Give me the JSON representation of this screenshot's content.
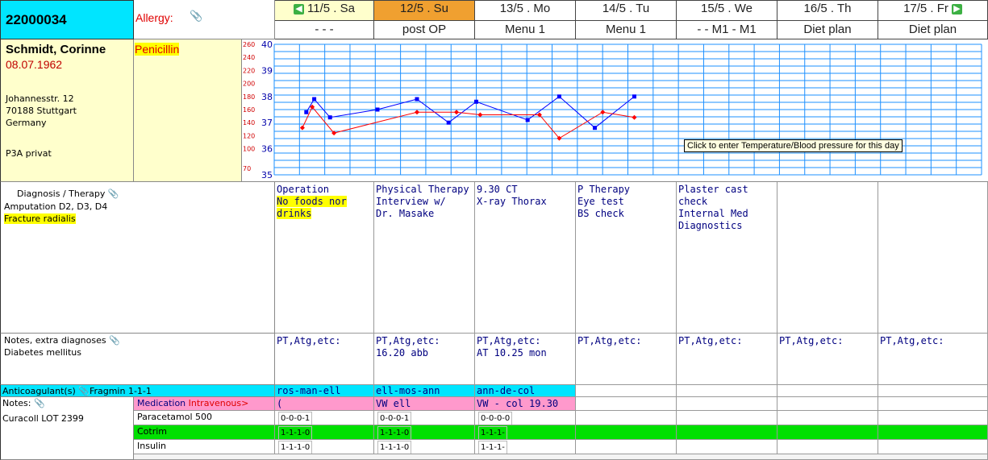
{
  "patient": {
    "id": "22000034",
    "name": "Schmidt, Corinne",
    "birthdate": "08.07.1962",
    "street": "Johannesstr. 12",
    "city": "70188 Stuttgart",
    "country": "Germany",
    "ward": "P3A privat"
  },
  "allergy": {
    "label": "Allergy:",
    "value": "Penicillin"
  },
  "days": [
    {
      "label": "11/5 . Sa",
      "menu": "- - -",
      "bg": "#ffffcc"
    },
    {
      "label": "12/5 . Su",
      "menu": "post OP",
      "bg": "#f0a030"
    },
    {
      "label": "13/5 . Mo",
      "menu": "Menu 1",
      "bg": "#ffffff"
    },
    {
      "label": "14/5 . Tu",
      "menu": "Menu 1",
      "bg": "#ffffff"
    },
    {
      "label": "15/5 . We",
      "menu": "- - M1 - M1",
      "bg": "#ffffff"
    },
    {
      "label": "16/5 . Th",
      "menu": "Diet plan",
      "bg": "#ffffff"
    },
    {
      "label": "17/5 . Fr",
      "menu": "Diet plan",
      "bg": "#ffffff"
    }
  ],
  "chart": {
    "temp_labels": [
      "40",
      "39",
      "38",
      "37",
      "36",
      "35"
    ],
    "bp_labels": [
      "260",
      "240",
      "220",
      "200",
      "180",
      "160",
      "140",
      "120",
      "100",
      "70"
    ],
    "tooltip": "Click to enter Temperature/Blood pressure for this day"
  },
  "chart_data": {
    "type": "line",
    "series": [
      {
        "values": [
          [
            0.2,
            37.4
          ],
          [
            0.4,
            37.9
          ],
          [
            0.8,
            37.2
          ],
          [
            2.0,
            37.5
          ],
          [
            3.0,
            37.9
          ],
          [
            3.8,
            37.0
          ],
          [
            4.5,
            37.8
          ],
          [
            5.8,
            37.1
          ],
          [
            6.6,
            38.0
          ],
          [
            7.5,
            36.8
          ],
          [
            8.5,
            38.0
          ]
        ]
      },
      {
        "values": [
          [
            0.1,
            36.8
          ],
          [
            0.35,
            37.6
          ],
          [
            0.9,
            36.6
          ],
          [
            3.0,
            37.4
          ],
          [
            4.0,
            37.4
          ],
          [
            4.6,
            37.3
          ],
          [
            6.1,
            37.3
          ],
          [
            6.6,
            36.4
          ],
          [
            7.7,
            37.4
          ],
          [
            8.5,
            37.2
          ]
        ]
      }
    ],
    "ylim": [
      35,
      40
    ]
  },
  "diagnosis": {
    "title": "Diagnosis / Therapy",
    "line1": "Amputation D2, D3, D4",
    "line2": "Fracture radialis"
  },
  "therapy": [
    {
      "lines": [
        "Operation"
      ],
      "hl": [
        "No foods nor",
        "drinks"
      ]
    },
    {
      "lines": [
        "Physical Therapy",
        "Interview w/",
        "Dr. Masake"
      ],
      "hl": []
    },
    {
      "lines": [
        "9.30 CT",
        "X-ray Thorax"
      ],
      "hl": []
    },
    {
      "lines": [
        "P Therapy",
        "Eye test",
        "BS check"
      ],
      "hl": []
    },
    {
      "lines": [
        "Plaster cast",
        "check",
        "Internal Med",
        "Diagnostics"
      ],
      "hl": []
    },
    {
      "lines": [],
      "hl": []
    },
    {
      "lines": [],
      "hl": []
    }
  ],
  "notes": {
    "title": "Notes, extra diagnoses",
    "line1": "Diabetes mellitus"
  },
  "day_notes": [
    [
      "PT,Atg,etc:"
    ],
    [
      "PT,Atg,etc:",
      "16.20 abb"
    ],
    [
      "PT,Atg,etc:",
      "AT 10.25 mon"
    ],
    [
      "PT,Atg,etc:"
    ],
    [
      "PT,Atg,etc:"
    ],
    [
      "PT,Atg,etc:"
    ],
    [
      "PT,Atg,etc:"
    ]
  ],
  "anticoag": {
    "label": "Anticoagulant(s)",
    "drug": "Fragmin 1-1-1",
    "days": [
      "ros-man-ell",
      "ell-mos-ann",
      "ann-de-col",
      "",
      "",
      "",
      ""
    ]
  },
  "notes2": {
    "label": "Notes:",
    "value": "Curacoll LOT 2399"
  },
  "medication": {
    "label": "Medication",
    "iv_label": "Intravenous>",
    "iv_days": [
      "(",
      "VW ell",
      "VW - col 19.30",
      "",
      "",
      "",
      ""
    ],
    "rows": [
      {
        "name": "Paracetamol 500",
        "color": "#ffffff",
        "days": [
          "0-0-0-1",
          "0-0-0-1",
          "0-0-0-0",
          "",
          "",
          "",
          ""
        ]
      },
      {
        "name": "Cotrim",
        "color": "#00e000",
        "days": [
          "1-1-1-0",
          "1-1-1-0",
          "1-1-1-",
          "",
          "",
          "",
          ""
        ]
      },
      {
        "name": "Insulin",
        "color": "#ffffff",
        "days": [
          "1-1-1-0",
          "1-1-1-0",
          "1-1-1-",
          "",
          "",
          "",
          ""
        ]
      }
    ]
  }
}
